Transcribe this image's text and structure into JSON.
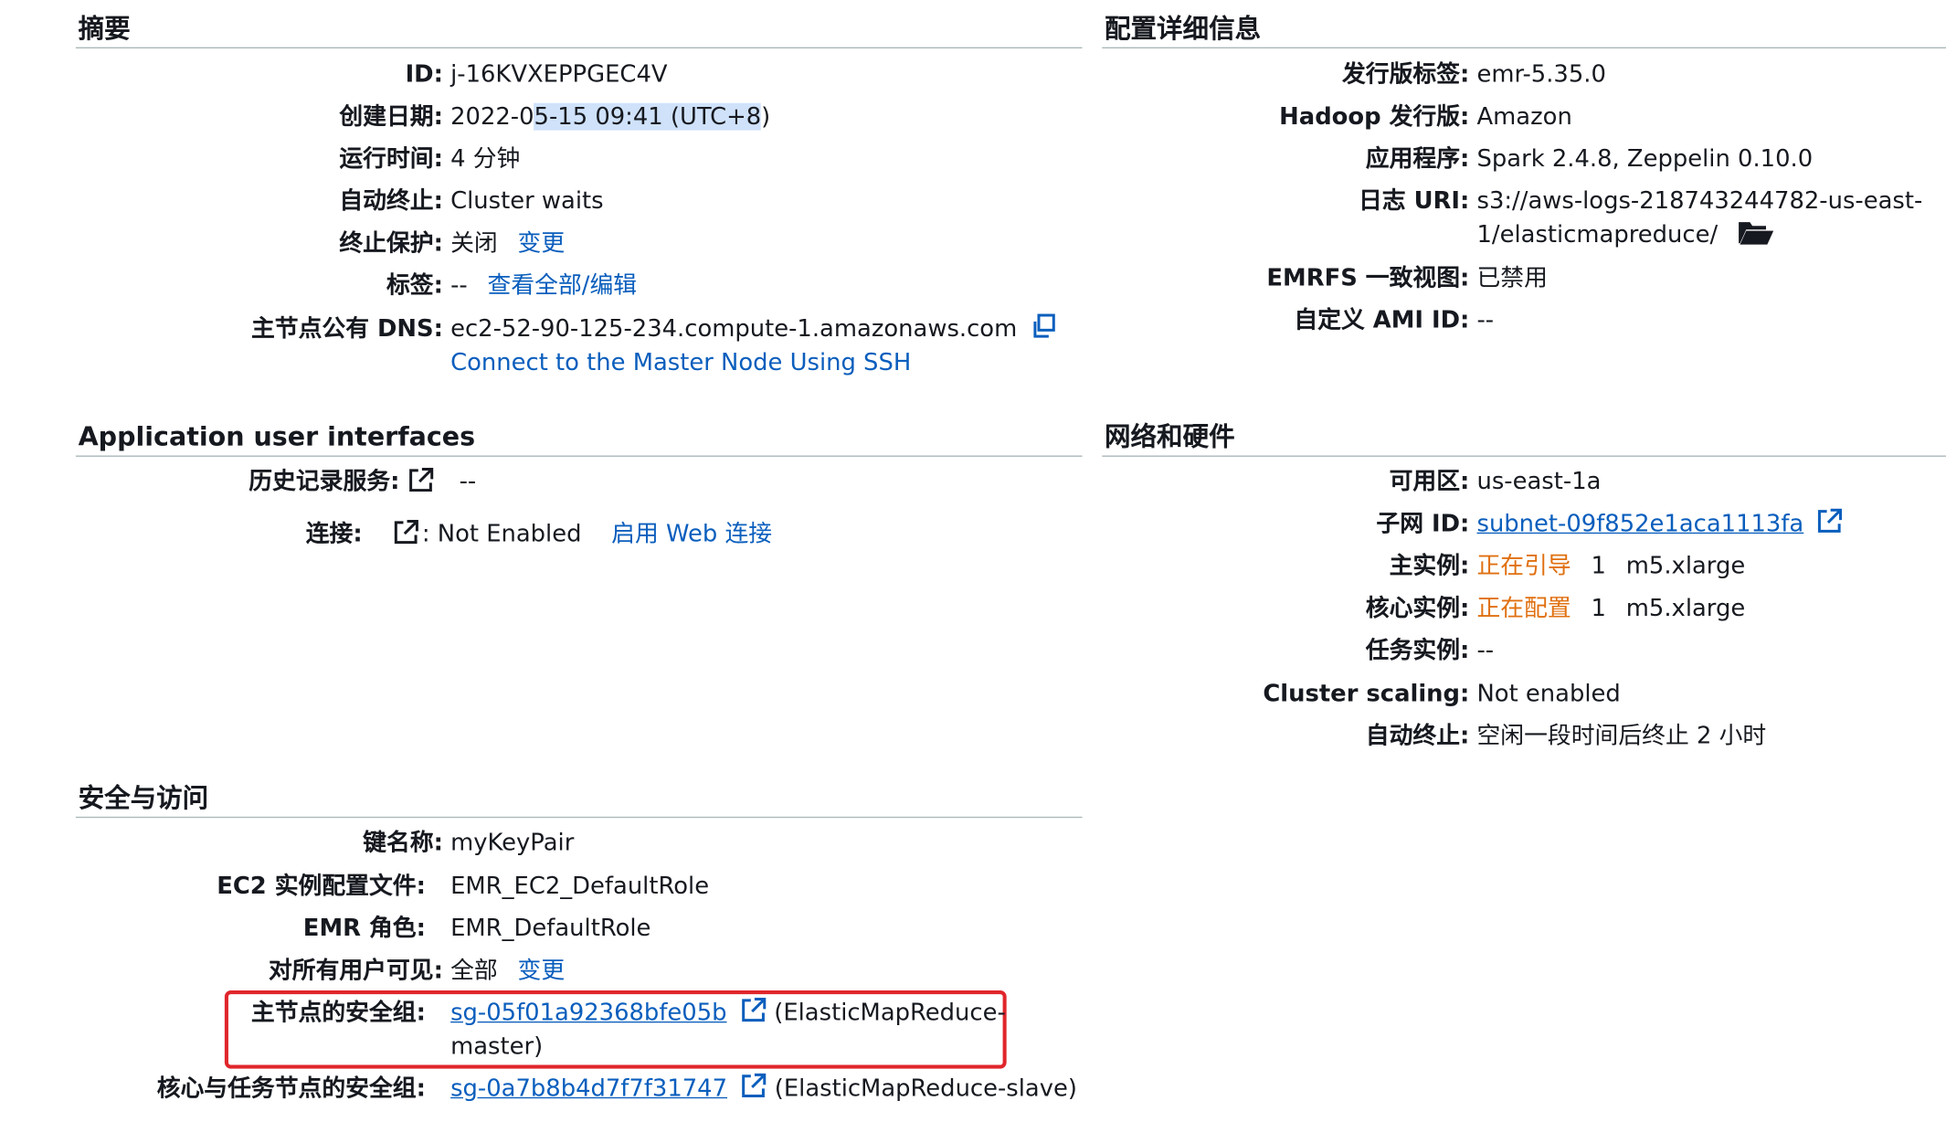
{
  "summary": {
    "title": "摘要",
    "id_label": "ID:",
    "id_value": "j-16KVXEPPGEC4V",
    "created_label": "创建日期:",
    "created_pre": "2022-0",
    "created_hl": "5-15 09:41 (UTC+8",
    "created_post": ")",
    "runtime_label": "运行时间:",
    "runtime_value": "4 分钟",
    "autoterm_label": "自动终止:",
    "autoterm_value": "Cluster waits",
    "termprot_label": "终止保护:",
    "termprot_value": "关闭",
    "termprot_link": "变更",
    "tags_label": "标签:",
    "tags_value": "--",
    "tags_link": "查看全部/编辑",
    "dns_label": "主节点公有 DNS:",
    "dns_value": "ec2-52-90-125-234.compute-1.amazonaws.com",
    "ssh_link": "Connect to the Master Node Using SSH"
  },
  "config": {
    "title": "配置详细信息",
    "release_label": "发行版标签:",
    "release_value": "emr-5.35.0",
    "hadoop_label": "Hadoop 发行版:",
    "hadoop_value": "Amazon",
    "apps_label": "应用程序:",
    "apps_value": "Spark 2.4.8, Zeppelin 0.10.0",
    "log_label": "日志 URI:",
    "log_value_1": "s3://aws-logs-218743244782-us-east-",
    "log_value_2": "1/elasticmapreduce/",
    "emrfs_label": "EMRFS 一致视图:",
    "emrfs_value": "已禁用",
    "ami_label": "自定义 AMI ID:",
    "ami_value": "--"
  },
  "apps": {
    "title": "Application user interfaces",
    "history_label": "历史记录服务:",
    "history_value": "--",
    "connect_label": "连接:",
    "connect_value": "Not Enabled",
    "connect_link": "启用 Web 连接"
  },
  "network": {
    "title": "网络和硬件",
    "az_label": "可用区:",
    "az_value": "us-east-1a",
    "subnet_label": "子网 ID:",
    "subnet_value": "subnet-09f852e1aca1113fa",
    "master_label": "主实例:",
    "master_status": "正在引导",
    "master_count": "1",
    "master_type": "m5.xlarge",
    "core_label": "核心实例:",
    "core_status": "正在配置",
    "core_count": "1",
    "core_type": "m5.xlarge",
    "task_label": "任务实例:",
    "task_value": "--",
    "scaling_label": "Cluster scaling:",
    "scaling_value": "Not enabled",
    "autoterm_label": "自动终止:",
    "autoterm_value": "空闲一段时间后终止 2 小时"
  },
  "security": {
    "title": "安全与访问",
    "key_label": "键名称:",
    "key_value": "myKeyPair",
    "ec2_label": "EC2 实例配置文件:",
    "ec2_value": "EMR_EC2_DefaultRole",
    "emr_label": "EMR 角色:",
    "emr_value": "EMR_DefaultRole",
    "visible_label": "对所有用户可见:",
    "visible_value": "全部",
    "visible_link": "变更",
    "master_sg_label": "主节点的安全组:",
    "master_sg_link": "sg-05f01a92368bfe05b",
    "master_sg_name_1": "(ElasticMapReduce-",
    "master_sg_name_2": "master)",
    "slave_sg_label": "核心与任务节点的安全组:",
    "slave_sg_link": "sg-0a7b8b4d7f7f31747",
    "slave_sg_name": "(ElasticMapReduce-slave)"
  },
  "colors": {
    "link": "#0a5ebd",
    "status": "#e07010",
    "highlight_box": "#e0262b"
  }
}
